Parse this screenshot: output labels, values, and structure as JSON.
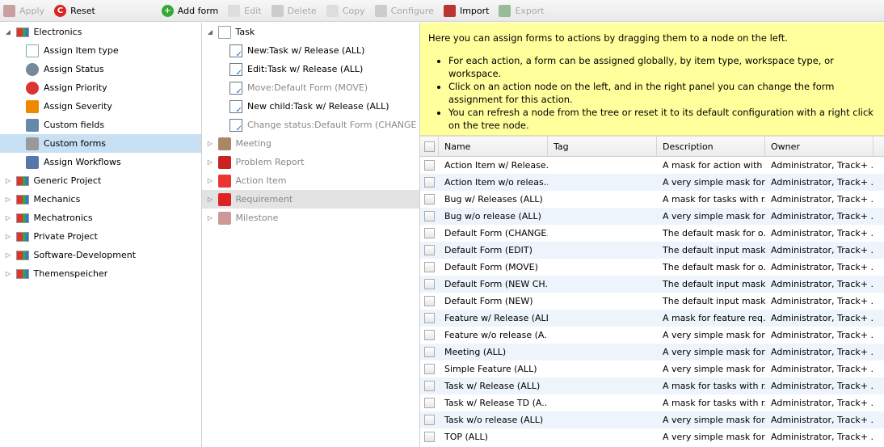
{
  "toolbar": [
    {
      "label": "Apply",
      "icon": "save-icon",
      "color": "#c8a0a0",
      "disabled": true
    },
    {
      "label": "Reset",
      "icon": "reset-icon",
      "color": "#d22",
      "disabled": false
    },
    {
      "gap": true
    },
    {
      "label": "Add form",
      "icon": "add-icon",
      "color": "#3a3",
      "disabled": false
    },
    {
      "label": "Edit",
      "icon": "edit-icon",
      "color": "#ddd",
      "disabled": true
    },
    {
      "label": "Delete",
      "icon": "delete-icon",
      "color": "#ccc",
      "disabled": true
    },
    {
      "label": "Copy",
      "icon": "copy-icon",
      "color": "#ddd",
      "disabled": true
    },
    {
      "label": "Configure",
      "icon": "wrench-icon",
      "color": "#ccc",
      "disabled": true
    },
    {
      "label": "Import",
      "icon": "import-icon",
      "color": "#b33",
      "disabled": false
    },
    {
      "label": "Export",
      "icon": "export-icon",
      "color": "#9b9",
      "disabled": true
    }
  ],
  "left_tree": [
    {
      "label": "Electronics",
      "level": 0,
      "expanded": true,
      "icon": "project-icon"
    },
    {
      "label": "Assign Item type",
      "level": 1,
      "icon": "document-icon"
    },
    {
      "label": "Assign Status",
      "level": 1,
      "icon": "status-icon"
    },
    {
      "label": "Assign Priority",
      "level": 1,
      "icon": "priority-icon"
    },
    {
      "label": "Assign Severity",
      "level": 1,
      "icon": "severity-icon"
    },
    {
      "label": "Custom fields",
      "level": 1,
      "icon": "custom-fields-icon"
    },
    {
      "label": "Custom forms",
      "level": 1,
      "icon": "custom-forms-icon",
      "selected": true
    },
    {
      "label": "Assign Workflows",
      "level": 1,
      "icon": "workflow-icon"
    },
    {
      "label": "Generic Project",
      "level": 0,
      "icon": "project-icon"
    },
    {
      "label": "Mechanics",
      "level": 0,
      "icon": "project-icon"
    },
    {
      "label": "Mechatronics",
      "level": 0,
      "icon": "project-icon"
    },
    {
      "label": "Private Project",
      "level": 0,
      "icon": "project-icon"
    },
    {
      "label": "Software-Development",
      "level": 0,
      "icon": "project-icon"
    },
    {
      "label": "Themenspeicher",
      "level": 0,
      "icon": "project-icon"
    }
  ],
  "mid_tree": [
    {
      "label": "Task",
      "level": 0,
      "expanded": true,
      "icon": "task-icon"
    },
    {
      "label": "New:Task w/ Release (ALL)",
      "level": 1,
      "icon": "form-icon"
    },
    {
      "label": "Edit:Task w/ Release (ALL)",
      "level": 1,
      "icon": "form-icon"
    },
    {
      "label": "Move:Default Form (MOVE)",
      "level": 1,
      "icon": "form-icon",
      "dim": true
    },
    {
      "label": "New child:Task w/ Release (ALL)",
      "level": 1,
      "icon": "form-icon"
    },
    {
      "label": "Change status:Default Form (CHANGE STATUS)",
      "level": 1,
      "icon": "form-icon",
      "dim": true
    },
    {
      "label": "Meeting",
      "level": 0,
      "icon": "meeting-icon",
      "dim": true
    },
    {
      "label": "Problem Report",
      "level": 0,
      "icon": "problem-report-icon",
      "dim": true
    },
    {
      "label": "Action Item",
      "level": 0,
      "icon": "action-item-icon",
      "dim": true
    },
    {
      "label": "Requirement",
      "level": 0,
      "icon": "requirement-icon",
      "dim": true,
      "highlight": true
    },
    {
      "label": "Milestone",
      "level": 0,
      "icon": "milestone-icon",
      "dim": true
    }
  ],
  "info": {
    "intro": "Here you can assign forms to actions by dragging them to a node on the left.",
    "bullets": [
      "For each action, a form can be assigned globally, by item type, workspace type, or workspace.",
      "Click on an action node on the left, and in the right panel you can change the form assignment for this action.",
      "You can refresh a node from the tree or reset it to its default configuration with a right click on the tree node."
    ]
  },
  "grid": {
    "columns": [
      "Name",
      "Tag",
      "Description",
      "Owner"
    ],
    "rows": [
      [
        "Action Item w/ Release...",
        "",
        "A mask for action with ...",
        "Administrator, Track+ ..."
      ],
      [
        "Action Item w/o releas...",
        "",
        "A very simple mask for...",
        "Administrator, Track+ ..."
      ],
      [
        "Bug w/ Releases (ALL)",
        "",
        "A mask for tasks with r...",
        "Administrator, Track+ ..."
      ],
      [
        "Bug w/o release (ALL)",
        "",
        "A very simple mask for...",
        "Administrator, Track+ ..."
      ],
      [
        "Default Form (CHANGE...",
        "",
        "The default mask for o...",
        "Administrator, Track+ ..."
      ],
      [
        "Default Form (EDIT)",
        "",
        "The default input mask...",
        "Administrator, Track+ ..."
      ],
      [
        "Default Form (MOVE)",
        "",
        "The default mask for o...",
        "Administrator, Track+ ..."
      ],
      [
        "Default Form (NEW CH...",
        "",
        "The default input mask...",
        "Administrator, Track+ ..."
      ],
      [
        "Default Form (NEW)",
        "",
        "The default input mask...",
        "Administrator, Track+ ..."
      ],
      [
        "Feature w/ Release (ALL)",
        "",
        "A mask for feature req...",
        "Administrator, Track+ ..."
      ],
      [
        "Feature w/o release (A...",
        "",
        "A very simple mask for...",
        "Administrator, Track+ ..."
      ],
      [
        "Meeting (ALL)",
        "",
        "A very simple mask for...",
        "Administrator, Track+ ..."
      ],
      [
        "Simple Feature (ALL)",
        "",
        "A very simple mask for...",
        "Administrator, Track+ ..."
      ],
      [
        "Task w/ Release (ALL)",
        "",
        "A mask for tasks with r...",
        "Administrator, Track+ ..."
      ],
      [
        "Task w/ Release TD (A...",
        "",
        "A mask for tasks with r...",
        "Administrator, Track+ ..."
      ],
      [
        "Task w/o release (ALL)",
        "",
        "A very simple mask for...",
        "Administrator, Track+ ..."
      ],
      [
        "TOP (ALL)",
        "",
        "A very simple mask for...",
        "Administrator, Track+ ..."
      ]
    ]
  }
}
